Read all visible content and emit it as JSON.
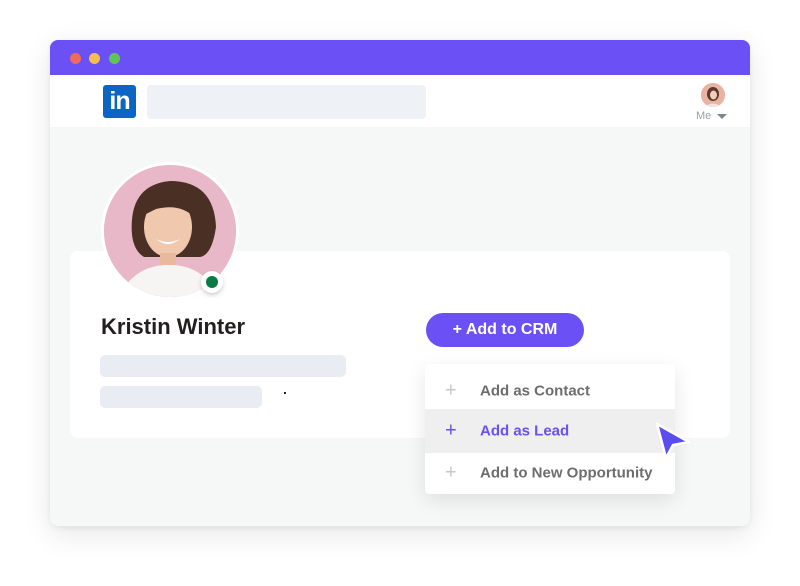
{
  "window": {
    "controls": [
      "close",
      "minimize",
      "maximize"
    ],
    "accent_color": "#6a50f5"
  },
  "navbar": {
    "logo_text": "in",
    "search_placeholder": "",
    "me_label": "Me"
  },
  "profile": {
    "name": "Kristin Winter",
    "status": "online",
    "status_color": "#0a7a45"
  },
  "actions": {
    "add_to_crm_label": "+ Add to CRM"
  },
  "crm_menu": {
    "items": [
      {
        "icon": "+",
        "label": "Add as Contact",
        "highlighted": false
      },
      {
        "icon": "+",
        "label": "Add as Lead",
        "highlighted": true
      },
      {
        "icon": "+",
        "label": "Add to New Opportunity",
        "highlighted": false
      }
    ]
  }
}
